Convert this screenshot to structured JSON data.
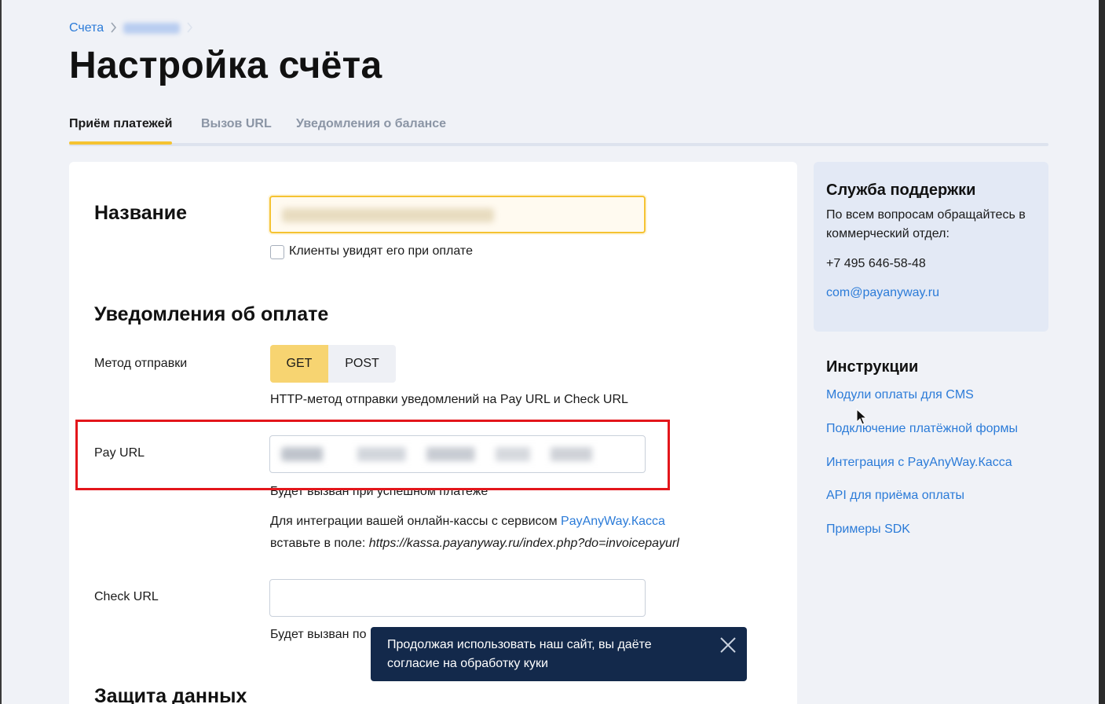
{
  "breadcrumb": {
    "root": "Счета"
  },
  "page_title": "Настройка счёта",
  "tabs": [
    {
      "label": "Приём платежей"
    },
    {
      "label": "Вызов URL"
    },
    {
      "label": "Уведомления о балансе"
    }
  ],
  "name_section": {
    "title": "Название",
    "checkbox_label": "Клиенты увидят его при оплате"
  },
  "notify_section": {
    "title": "Уведомления об оплате",
    "method_label": "Метод отправки",
    "method_options": [
      "GET",
      "POST"
    ],
    "method_selected": "GET",
    "method_help": "HTTP-метод отправки уведомлений на Pay URL и Check URL",
    "pay_url_label": "Pay URL",
    "pay_url_help": "Будет вызван при успешном платеже",
    "kassa_text_1": "Для интеграции вашей онлайн-кассы с сервисом ",
    "kassa_link": "PayAnyWay.Касса",
    "kassa_text_2": "вставьте в поле: ",
    "kassa_url": "https://kassa.payanyway.ru/index.php?do=invoicepayurl",
    "check_url_label": "Check URL",
    "check_url_value": "",
    "check_url_help": "Будет вызван по"
  },
  "data_section": {
    "title": "Защита данных"
  },
  "support": {
    "title": "Служба поддержки",
    "text": "По всем вопросам обращайтесь в коммерческий отдел:",
    "phone": "+7 495 646-58-48",
    "email": "com@payanyway.ru"
  },
  "instructions": {
    "title": "Инструкции",
    "links": [
      "Модули оплаты для CMS",
      "Подключение платёжной формы",
      "Интеграция с PayAnyWay.Касса",
      "API для приёма оплаты",
      "Примеры SDK"
    ]
  },
  "cookie_toast": {
    "text": "Продолжая использовать наш сайт, вы даёте согласие на обработку куки"
  },
  "colors": {
    "accent": "#f5c332",
    "link": "#2b7bd8",
    "toast_bg": "#13294b",
    "highlight": "#e3161b"
  }
}
